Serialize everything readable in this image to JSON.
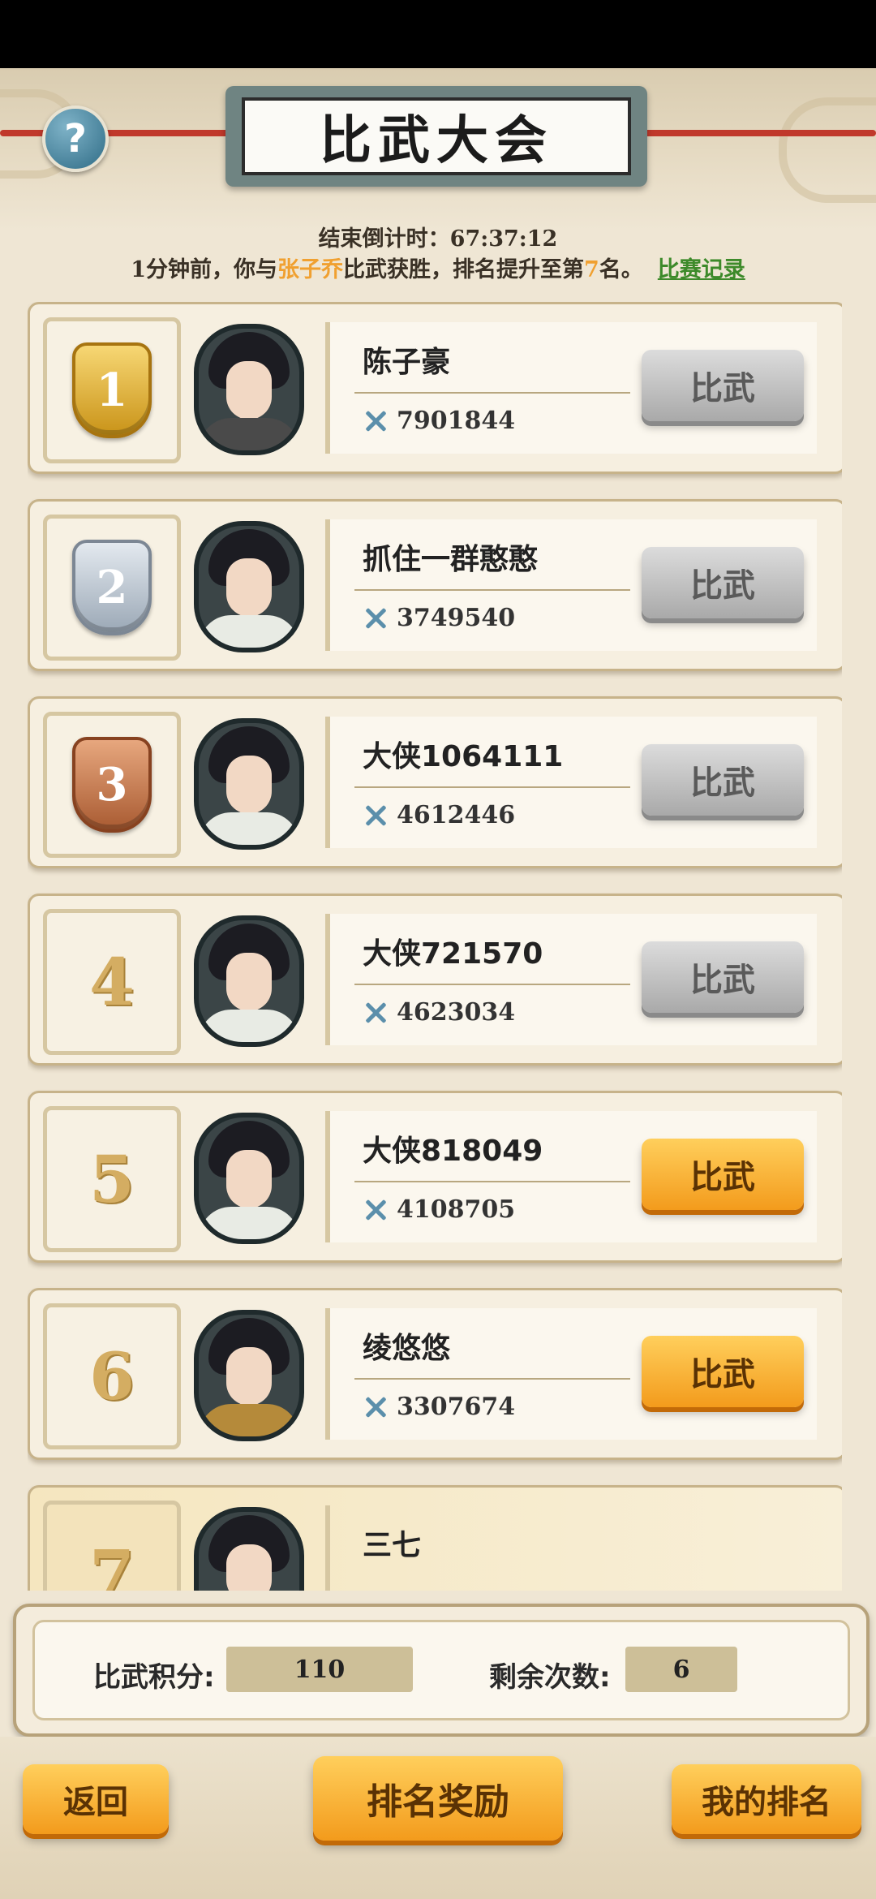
{
  "header": {
    "title": "比武大会",
    "help_icon": "question-icon",
    "help_label": "?"
  },
  "countdown": {
    "label": "结束倒计时：",
    "value": "67:37:12"
  },
  "notice": {
    "prefix": "1分钟前，你与",
    "opponent": "张子乔",
    "middle": "比武获胜，排名提升至第",
    "rank": "7",
    "suffix": "名。",
    "link": "比赛记录"
  },
  "ranking": [
    {
      "rank": "1",
      "medal": "gold",
      "name": "陈子豪",
      "power": "7901844",
      "button": "比武",
      "active": false
    },
    {
      "rank": "2",
      "medal": "silver",
      "name": "抓住一群憨憨",
      "power": "3749540",
      "button": "比武",
      "active": false
    },
    {
      "rank": "3",
      "medal": "bronze",
      "name": "大侠1064111",
      "power": "4612446",
      "button": "比武",
      "active": false
    },
    {
      "rank": "4",
      "medal": "none",
      "name": "大侠721570",
      "power": "4623034",
      "button": "比武",
      "active": false
    },
    {
      "rank": "5",
      "medal": "none",
      "name": "大侠818049",
      "power": "4108705",
      "button": "比武",
      "active": true
    },
    {
      "rank": "6",
      "medal": "none",
      "name": "绫悠悠",
      "power": "3307674",
      "button": "比武",
      "active": true
    },
    {
      "rank": "7",
      "medal": "none",
      "name": "三七",
      "power": "",
      "button": "",
      "active": false,
      "current": true
    }
  ],
  "score": {
    "points_label": "比武积分:",
    "points_value": "110",
    "remaining_label": "剩余次数:",
    "remaining_value": "6"
  },
  "footer": {
    "back": "返回",
    "rewards": "排名奖励",
    "my_rank": "我的排名"
  },
  "colors": {
    "highlight": "#f0a030",
    "link": "#3d8a2a",
    "active_button": "#f39b1c"
  }
}
